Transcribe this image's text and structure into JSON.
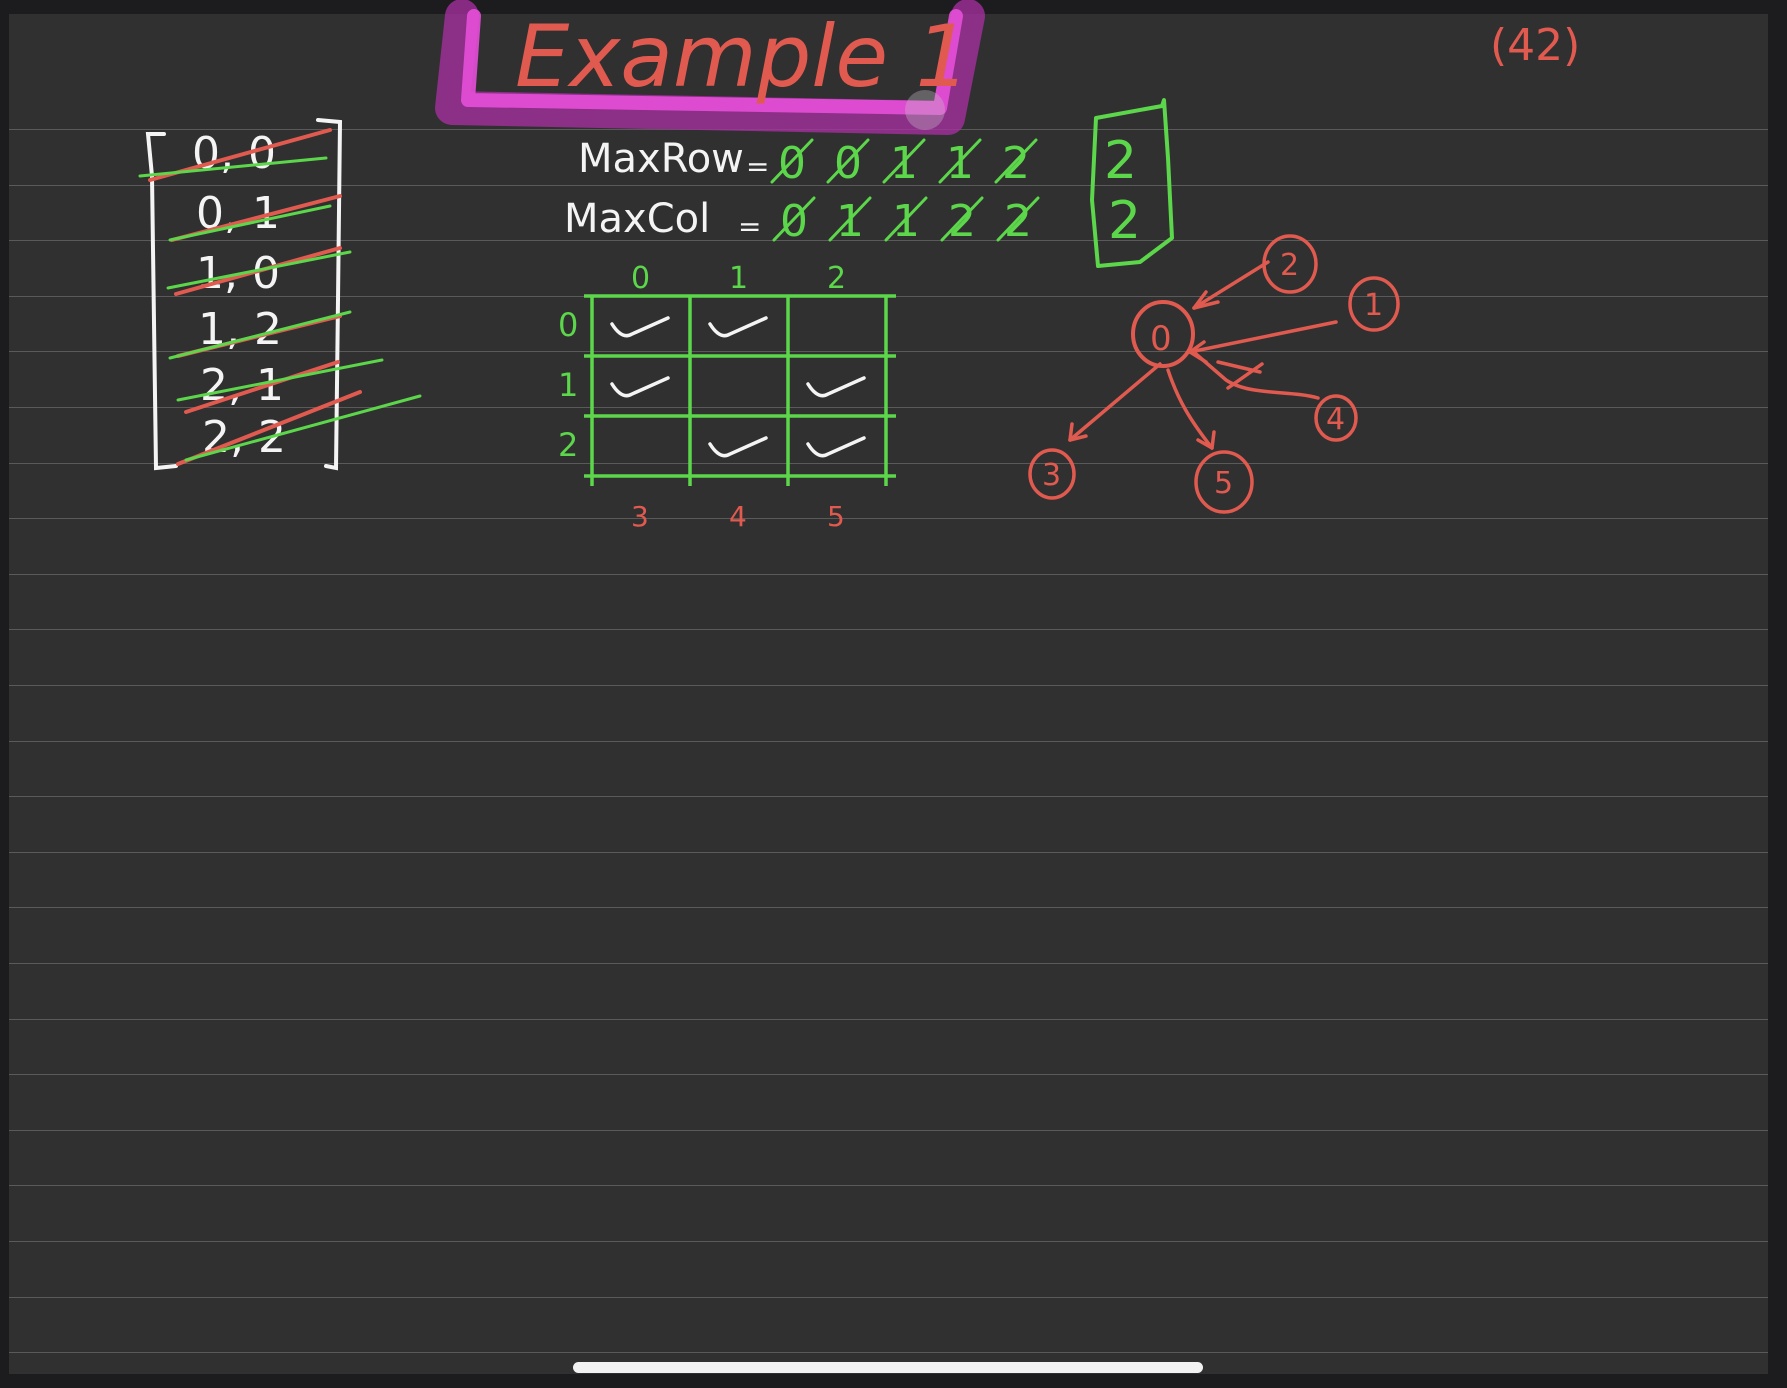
{
  "title": "Example 1",
  "page_number": "(42)",
  "colors": {
    "background": "#303030",
    "ruled_line": "#5a5a5a",
    "ink_white": "#f4f4f4",
    "ink_green": "#5cd64a",
    "ink_red": "#e05a4f",
    "highlighter_magenta": "#d338c9"
  },
  "queue_list": {
    "items": [
      "0, 0",
      "0, 1",
      "1, 0",
      "1, 2",
      "2, 1",
      "2, 2"
    ]
  },
  "max_values": {
    "max_row_label": "MaxRow",
    "max_row_eq": "=",
    "max_row_history": [
      "0",
      "0",
      "1",
      "1",
      "2"
    ],
    "max_row_result": "2",
    "max_col_label": "MaxCol",
    "max_col_eq": "=",
    "max_col_history": [
      "0",
      "1",
      "1",
      "2",
      "2"
    ],
    "max_col_result": "2"
  },
  "grid": {
    "col_headers": [
      "0",
      "1",
      "2"
    ],
    "row_headers": [
      "0",
      "1",
      "2"
    ],
    "bottom_labels": [
      "3",
      "4",
      "5"
    ],
    "cells": [
      [
        true,
        true,
        false
      ],
      [
        true,
        false,
        true
      ],
      [
        false,
        true,
        true
      ]
    ]
  },
  "graph": {
    "center_node": "0",
    "nodes": [
      "2",
      "1",
      "4",
      "3",
      "5"
    ]
  }
}
